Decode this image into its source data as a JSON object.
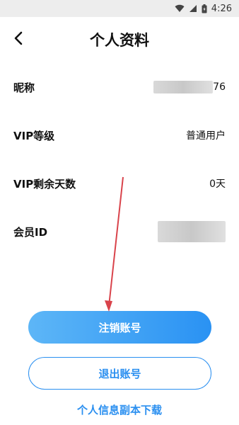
{
  "status_bar": {
    "time": "4:26",
    "icons": [
      "wifi-icon",
      "signal-icon",
      "battery-icon"
    ]
  },
  "header": {
    "title": "个人资料",
    "back_icon": "chevron-left-icon"
  },
  "profile": {
    "nickname": {
      "label": "昵称",
      "value_suffix": "76"
    },
    "vip_level": {
      "label": "VIP等级",
      "value": "普通用户"
    },
    "vip_days": {
      "label": "VIP剩余天数",
      "value": "0天"
    },
    "member_id": {
      "label": "会员ID"
    }
  },
  "actions": {
    "cancel_account": "注销账号",
    "logout": "退出账号",
    "download_copy": "个人信息副本下载"
  },
  "colors": {
    "accent": "#2a8ff0",
    "button_gradient_start": "#5db6f7",
    "button_gradient_end": "#2a92f3",
    "annotation_arrow": "#d9434b"
  }
}
